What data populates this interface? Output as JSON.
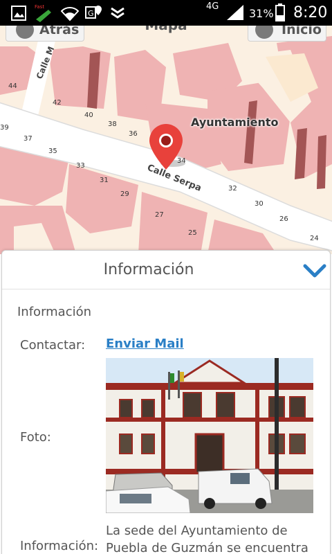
{
  "status_bar": {
    "network": "4G",
    "battery": "31%",
    "time": "8:20",
    "icons": [
      "gallery-icon",
      "app-notification-icon",
      "wifi-icon",
      "location-icon",
      "download-check-icon",
      "signal-icon",
      "battery-icon"
    ]
  },
  "nav": {
    "back_label": "Atrás",
    "title": "Mapa",
    "home_label": "Inicio"
  },
  "map": {
    "place_label": "Ayuntamiento",
    "street_labels": [
      "Calle Serpa",
      "Calle M"
    ],
    "house_numbers": [
      "44",
      "42",
      "40",
      "39",
      "38",
      "37",
      "36",
      "35",
      "34",
      "33",
      "32",
      "31",
      "30",
      "29",
      "27",
      "26",
      "25",
      "24"
    ],
    "colors": {
      "building": "#efb3b3",
      "building_dark": "#a35555",
      "ground": "#fbf0e2",
      "road": "#ffffff",
      "marker": "#e8413b"
    }
  },
  "panel": {
    "title": "Información",
    "section_title": "Información",
    "contact_label": "Contactar:",
    "contact_link": "Enviar Mail",
    "photo_label": "Foto:",
    "info_label": "Información:",
    "info_text": "La sede del Ayuntamiento de Puebla de Guzmán se encuentra",
    "accent_color": "#2a7fc6"
  }
}
